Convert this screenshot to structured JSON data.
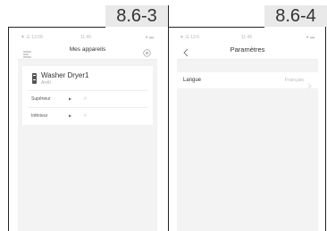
{
  "panels": [
    {
      "label": "8.6-3",
      "status": {
        "left": "▼ ☰ 13:58 ·",
        "center": "11:45",
        "right": "● ▬"
      },
      "header": {
        "title": "Mes appareils",
        "menu_icon": "menu-icon",
        "add_icon": "add-circle-icon"
      },
      "device": {
        "name": "Washer Dryer1",
        "status": "Arrêt",
        "icon": "washer-dryer-icon"
      },
      "units": [
        {
          "label": "Supérieur",
          "value": "-/-"
        },
        {
          "label": "Inférieur",
          "value": "-/-"
        }
      ]
    },
    {
      "label": "8.6-4",
      "status": {
        "left": "▼ ☰ 13:5·",
        "center": "11:45",
        "right": "● ▬"
      },
      "header": {
        "title": "Paramètres",
        "back_icon": "back-chevron-icon"
      },
      "settings": [
        {
          "label": "Langue",
          "value": "Français"
        }
      ]
    }
  ],
  "colors": {
    "frame": "#222222",
    "label_bg": "#e9e9e9",
    "screen_bg": "#f3f3f3"
  }
}
